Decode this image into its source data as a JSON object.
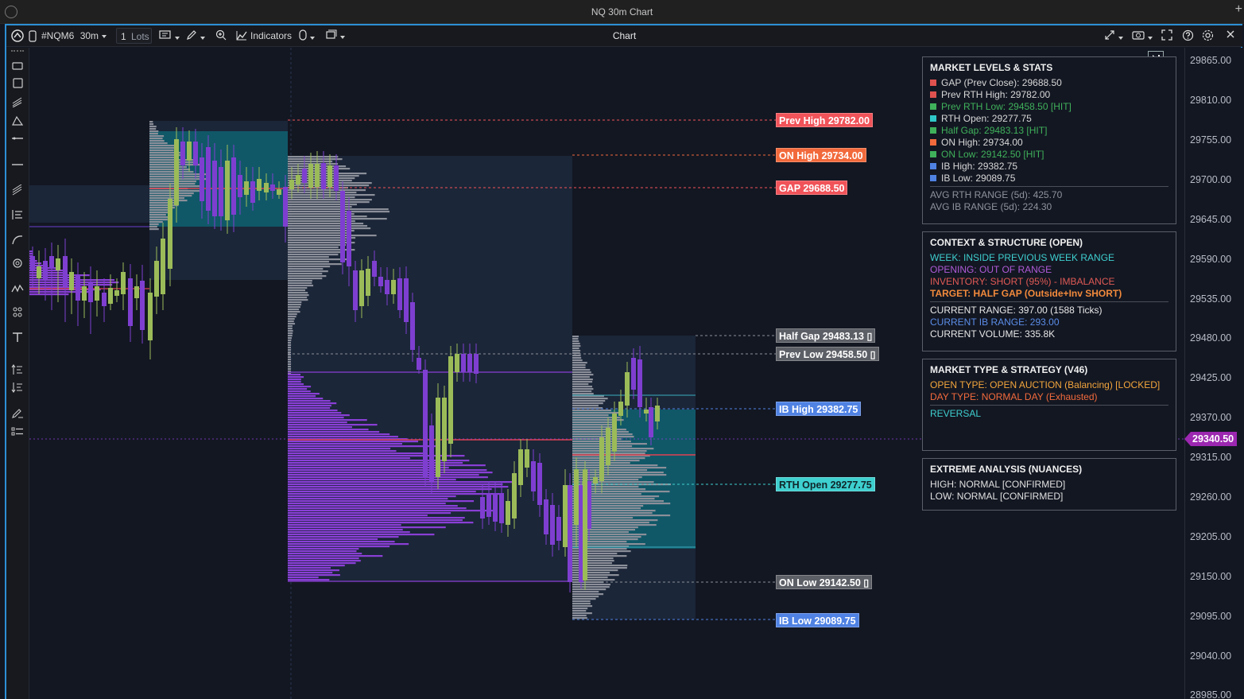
{
  "window": {
    "title": "NQ 30m Chart"
  },
  "toolbar": {
    "symbol": "#NQM6",
    "timeframe": "30m",
    "lots_qty": "1",
    "lots_label": "Lots",
    "indicators_label": "Indicators",
    "center_title": "Chart"
  },
  "price_axis": {
    "ticks": [
      "29865.00",
      "29810.00",
      "29755.00",
      "29700.00",
      "29645.00",
      "29590.00",
      "29535.00",
      "29480.00",
      "29425.00",
      "29370.00",
      "29315.00",
      "29260.00",
      "29205.00",
      "29150.00",
      "29095.00",
      "29040.00",
      "28985.00"
    ],
    "current_price": "29340.50",
    "current_price_color": "#9c27b0"
  },
  "levels": [
    {
      "text": "Prev High 29782.00",
      "bg": "#f05359",
      "fg": "#ffffff"
    },
    {
      "text": "ON High 29734.00",
      "bg": "#f26a3c",
      "fg": "#ffffff"
    },
    {
      "text": "GAP 29688.50",
      "bg": "#f05359",
      "fg": "#ffffff"
    },
    {
      "text": "Half Gap 29483.13 ▯",
      "bg": "#5c5f66",
      "fg": "#ffffff"
    },
    {
      "text": "Prev Low 29458.50 ▯",
      "bg": "#5c5f66",
      "fg": "#ffffff"
    },
    {
      "text": "IB High 29382.75",
      "bg": "#4f82e3",
      "fg": "#ffffff"
    },
    {
      "text": "RTH Open 29277.75",
      "bg": "#3ecfcf",
      "fg": "#10262a"
    },
    {
      "text": "ON Low 29142.50 ▯",
      "bg": "#5c5f66",
      "fg": "#ffffff"
    },
    {
      "text": "IB Low 29089.75",
      "bg": "#4f82e3",
      "fg": "#ffffff"
    }
  ],
  "panels": {
    "market_levels": {
      "title": "MARKET LEVELS & STATS",
      "items": [
        {
          "text": "GAP (Prev Close): 29688.50",
          "color": "#d8d8d8",
          "marker": "#e0524f"
        },
        {
          "text": "Prev RTH High: 29782.00",
          "color": "#d8d8d8",
          "marker": "#e0524f"
        },
        {
          "text": "Prev RTH Low: 29458.50 [HIT]",
          "color": "#3fb15b",
          "marker": "#3fb15b"
        },
        {
          "text": "RTH Open: 29277.75",
          "color": "#d8d8d8",
          "marker": "#30c9c9"
        },
        {
          "text": "Half Gap: 29483.13 [HIT]",
          "color": "#3fb15b",
          "marker": "#3fb15b"
        },
        {
          "text": "ON High: 29734.00",
          "color": "#d8d8d8",
          "marker": "#f26a3c"
        },
        {
          "text": "ON Low: 29142.50 [HIT]",
          "color": "#3fb15b",
          "marker": "#3fb15b"
        },
        {
          "text": "IB High: 29382.75",
          "color": "#d8d8d8",
          "marker": "#4f82e3"
        },
        {
          "text": "IB Low: 29089.75",
          "color": "#d8d8d8",
          "marker": "#4f82e3"
        }
      ],
      "footer": [
        "AVG RTH RANGE (5d): 425.70",
        "AVG IB RANGE (5d): 224.30"
      ]
    },
    "context": {
      "title": "CONTEXT & STRUCTURE (OPEN)",
      "lines": [
        {
          "text": "WEEK: INSIDE PREVIOUS WEEK RANGE",
          "color": "#3ecfcf"
        },
        {
          "text": "OPENING: OUT OF RANGE",
          "color": "#b05ad8"
        },
        {
          "text": "INVENTORY: SHORT (95%) - IMBALANCE",
          "color": "#e05a55"
        },
        {
          "text": "TARGET: HALF GAP (Outside+Inv SHORT)",
          "color": "#f28a3c"
        }
      ],
      "stats": [
        {
          "text": "CURRENT RANGE: 397.00 (1588 Ticks)",
          "color": "#e8e8e8"
        },
        {
          "text": "CURRENT IB RANGE: 293.00",
          "color": "#5b8de8"
        },
        {
          "text": "CURRENT VOLUME: 335.8K",
          "color": "#e8e8e8"
        }
      ]
    },
    "market_type": {
      "title": "MARKET TYPE & STRATEGY (V46)",
      "lines": [
        {
          "text": "OPEN TYPE: OPEN AUCTION (Balancing) [LOCKED]",
          "color": "#f2a53c"
        },
        {
          "text": "DAY TYPE: NORMAL DAY (Exhausted)",
          "color": "#f26a3c"
        }
      ],
      "strategy": {
        "text": "REVERSAL",
        "color": "#3ecfcf"
      }
    },
    "extreme": {
      "title": "EXTREME ANALYSIS (NUANCES)",
      "lines": [
        "HIGH: NORMAL [CONFIRMED]",
        "LOW: NORMAL [CONFIRMED]"
      ]
    }
  },
  "chart_data": {
    "type": "candlestick",
    "ylim": [
      28985,
      29870
    ],
    "up_color": "#9bbb59",
    "down_color": "#7e3fd0",
    "value_area_color": "#0e7c86",
    "profile_color": "#8a3fd6"
  }
}
